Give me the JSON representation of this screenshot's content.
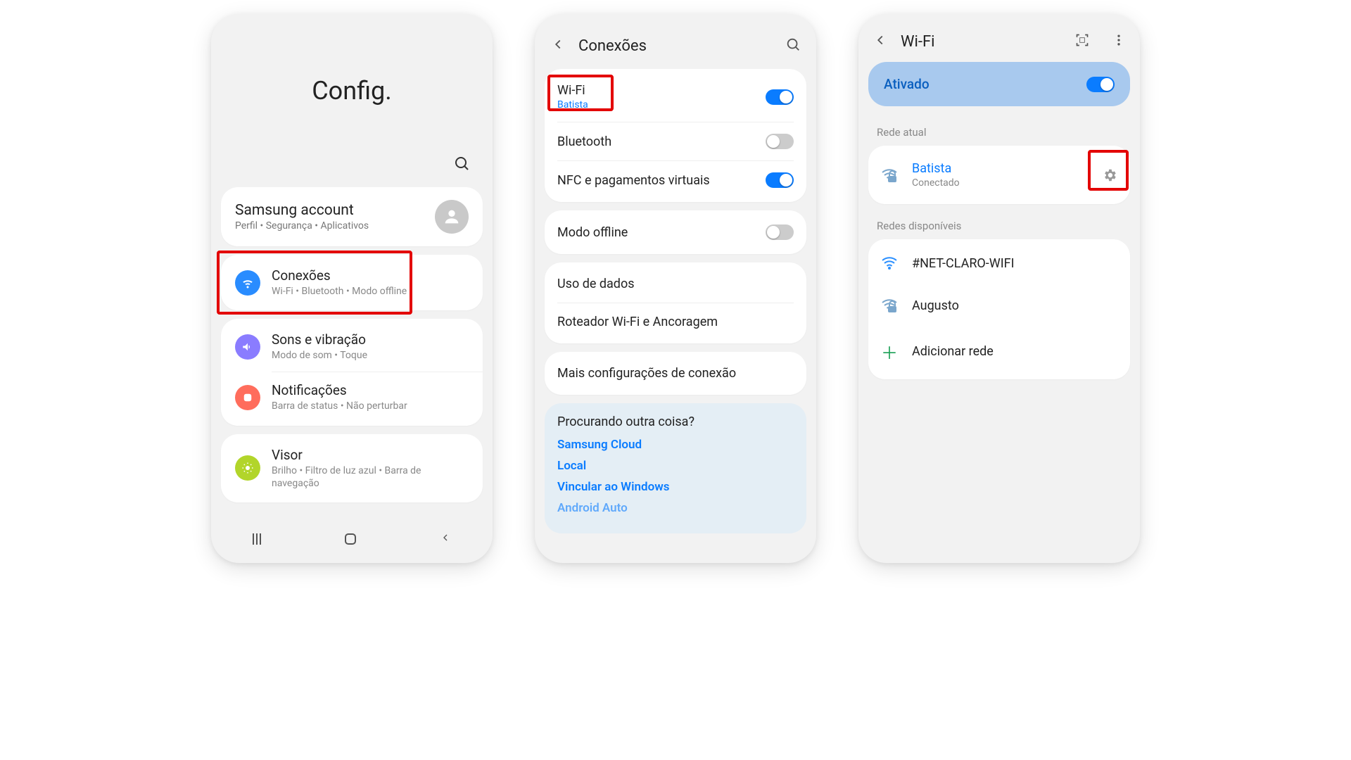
{
  "phone1": {
    "title": "Config.",
    "account": {
      "title": "Samsung account",
      "subtitle": "Perfil  •  Segurança  •  Aplicativos"
    },
    "items": [
      {
        "title": "Conexões",
        "subtitle": "Wi-Fi  •  Bluetooth  •  Modo offline"
      },
      {
        "title": "Sons e vibração",
        "subtitle": "Modo de som  •  Toque"
      },
      {
        "title": "Notificações",
        "subtitle": "Barra de status  •  Não perturbar"
      },
      {
        "title": "Visor",
        "subtitle": "Brilho  •  Filtro de luz azul  •  Barra de navegação"
      }
    ]
  },
  "phone2": {
    "header": "Conexões",
    "rows": {
      "wifi": {
        "title": "Wi-Fi",
        "subtitle": "Batista"
      },
      "bt": {
        "title": "Bluetooth"
      },
      "nfc": {
        "title": "NFC e pagamentos virtuais"
      },
      "offline": {
        "title": "Modo offline"
      },
      "data": {
        "title": "Uso de dados"
      },
      "hotspot": {
        "title": "Roteador Wi-Fi e Ancoragem"
      },
      "more": {
        "title": "Mais configurações de conexão"
      }
    },
    "lookingFor": {
      "heading": "Procurando outra coisa?",
      "links": [
        "Samsung Cloud",
        "Local",
        "Vincular ao Windows",
        "Android Auto"
      ]
    }
  },
  "phone3": {
    "header": "Wi-Fi",
    "status": "Ativado",
    "currentLabel": "Rede atual",
    "current": {
      "name": "Batista",
      "status": "Conectado"
    },
    "availableLabel": "Redes disponíveis",
    "networks": [
      "#NET-CLARO-WIFI",
      "Augusto"
    ],
    "addNetwork": "Adicionar rede"
  }
}
